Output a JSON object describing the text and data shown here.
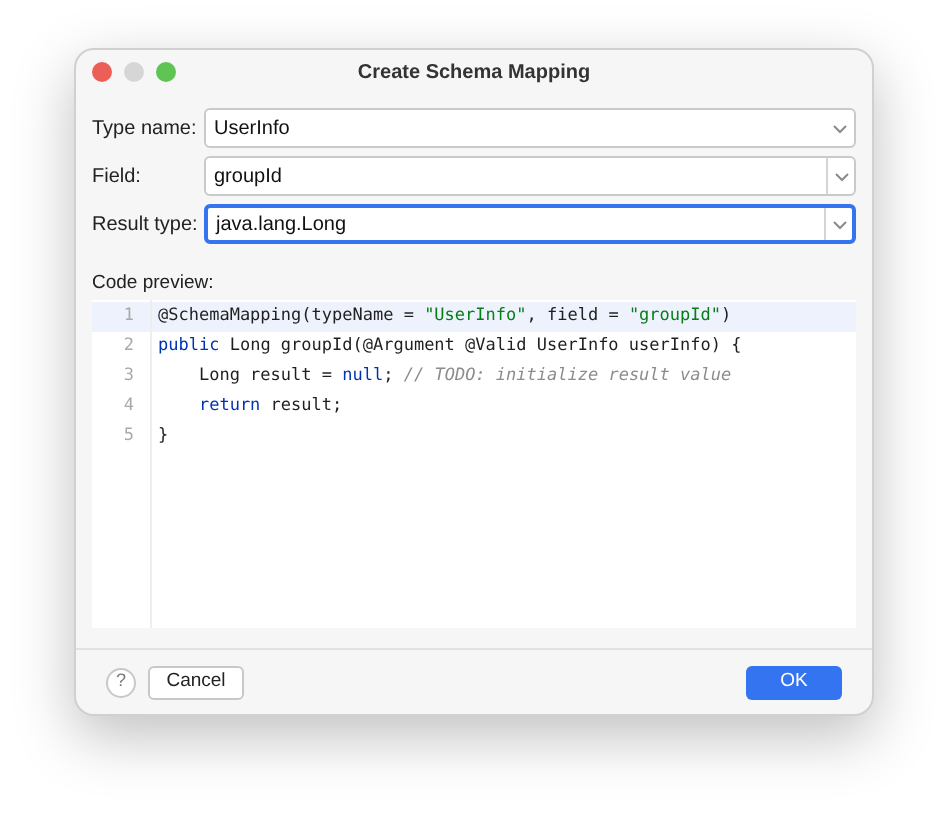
{
  "window": {
    "title": "Create Schema Mapping"
  },
  "fields": [
    {
      "label": "Type name:",
      "value": "UserInfo",
      "editable": false,
      "focused": false
    },
    {
      "label": "Field:",
      "value": "groupId",
      "editable": true,
      "focused": false
    },
    {
      "label": "Result type:",
      "value": "java.lang.Long",
      "editable": true,
      "focused": true
    }
  ],
  "code_preview": {
    "label": "Code preview:",
    "lines": [
      {
        "number": "1",
        "current": true,
        "tokens": [
          {
            "text": "@SchemaMapping(typeName = ",
            "kind": "plain"
          },
          {
            "text": "\"UserInfo\"",
            "kind": "string"
          },
          {
            "text": ", field = ",
            "kind": "plain"
          },
          {
            "text": "\"groupId\"",
            "kind": "string"
          },
          {
            "text": ")",
            "kind": "plain"
          }
        ]
      },
      {
        "number": "2",
        "current": false,
        "tokens": [
          {
            "text": "public",
            "kind": "keyword"
          },
          {
            "text": " Long groupId(@Argument @Valid UserInfo userInfo) {",
            "kind": "plain"
          }
        ]
      },
      {
        "number": "3",
        "current": false,
        "tokens": [
          {
            "text": "    Long result = ",
            "kind": "plain"
          },
          {
            "text": "null",
            "kind": "keyword"
          },
          {
            "text": "; ",
            "kind": "plain"
          },
          {
            "text": "// TODO: initialize result value",
            "kind": "comment"
          }
        ]
      },
      {
        "number": "4",
        "current": false,
        "tokens": [
          {
            "text": "    return",
            "kind": "keyword"
          },
          {
            "text": " result;",
            "kind": "plain"
          }
        ]
      },
      {
        "number": "5",
        "current": false,
        "tokens": [
          {
            "text": "}",
            "kind": "plain"
          }
        ]
      }
    ]
  },
  "footer": {
    "help": "?",
    "buttons": [
      {
        "label": "Cancel",
        "kind": "secondary"
      },
      {
        "label": "OK",
        "kind": "primary"
      }
    ]
  }
}
